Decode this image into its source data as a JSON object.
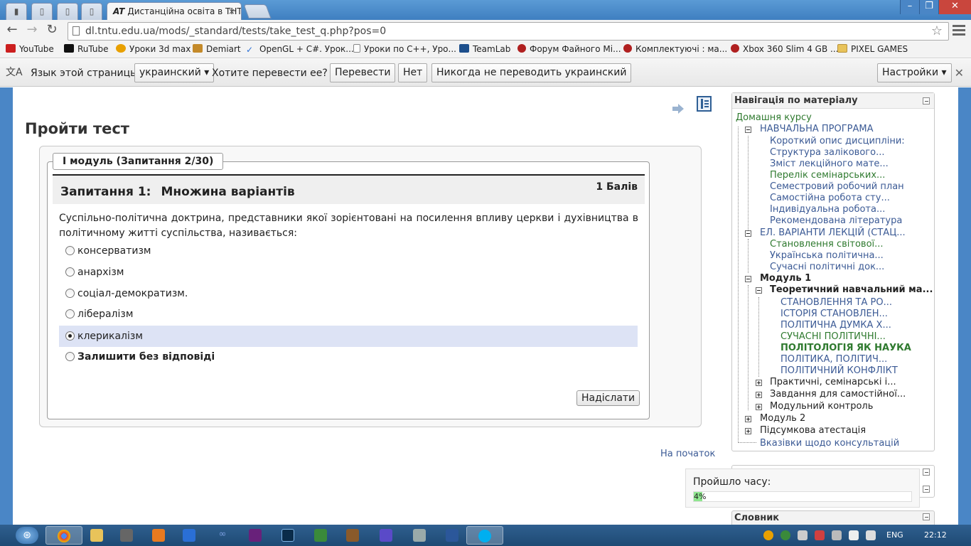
{
  "browser": {
    "tab_title": "Дистанційна освіта в ТНТ",
    "tab_favicon": "AT",
    "url": "dl.tntu.edu.ua/mods/_standard/tests/take_test_q.php?pos=0"
  },
  "bookmarks": [
    {
      "label": "YouTube",
      "icon": "youtube-icon",
      "color": "#cc1f1f"
    },
    {
      "label": "RuTube",
      "icon": "rutube-icon",
      "color": "#111111"
    },
    {
      "label": "Уроки 3d max",
      "icon": "3dmax-icon",
      "color": "#e8a000"
    },
    {
      "label": "Demiart",
      "icon": "demiart-icon",
      "color": "#c48a2a"
    },
    {
      "label": "OpenGL + C#. Урок...",
      "icon": "check-icon",
      "color": "#2a6fd6"
    },
    {
      "label": "Уроки по C++, Уро...",
      "icon": "page-icon",
      "color": "#ffffff"
    },
    {
      "label": "TeamLab",
      "icon": "teamlab-icon",
      "color": "#1d4f8c"
    },
    {
      "label": "Форум Файного Мі...",
      "icon": "forum-icon",
      "color": "#b02020"
    },
    {
      "label": "Комплектуючі : ма...",
      "icon": "forum-icon",
      "color": "#b02020"
    },
    {
      "label": "Xbox 360 Slim 4 GB ...",
      "icon": "forum-icon",
      "color": "#b02020"
    },
    {
      "label": "PIXEL GAMES",
      "icon": "folder-icon",
      "color": "#e8c35a"
    }
  ],
  "translate_bar": {
    "prompt": "Язык этой страницы",
    "language": "украинский",
    "question": "Хотите перевести ее?",
    "translate_btn": "Перевести",
    "no_btn": "Нет",
    "never_btn": "Никогда не переводить украинский",
    "settings_btn": "Настройки"
  },
  "page": {
    "title": "Пройти тест",
    "legend": "І модуль (Запитання 2/30)",
    "question_label": "Запитання 1:",
    "question_type": "Множина варіантів",
    "score": "1 Балів",
    "question_text": "Суспільно-політична доктрина, представники якої зорієнтовані на посилення впливу церкви і духівництва в політичному житті суспільства, називається:",
    "options": [
      {
        "label": "консерватизм",
        "selected": false,
        "bold": false
      },
      {
        "label": "анархізм",
        "selected": false,
        "bold": false
      },
      {
        "label": "соціал-демократизм.",
        "selected": false,
        "bold": false
      },
      {
        "label": "лібералізм",
        "selected": false,
        "bold": false
      },
      {
        "label": "клерикалізм",
        "selected": true,
        "bold": false
      },
      {
        "label": "Залишити без відповіді",
        "selected": false,
        "bold": true
      }
    ],
    "submit_label": "Надіслати",
    "to_top": "На початок"
  },
  "nav": {
    "title": "Навігація по матеріалу",
    "home": "Домашня курсу",
    "section1": "НАВЧАЛЬНА ПРОГРАМА",
    "section1_items": [
      "Короткий опис дисципліни:",
      "Структура залікового...",
      "Зміст лекційного мате...",
      "Перелік семінарських...",
      "Семестровий робочий план",
      "Самостійна робота сту...",
      "Індивідуальна робота...",
      "Рекомендована література"
    ],
    "section2": "ЕЛ. ВАРІАНТИ ЛЕКЦІЙ (СТАЦ...",
    "section2_items": [
      "Становлення світової...",
      "Українська політична...",
      "Сучасні політичні док..."
    ],
    "module1": "Модуль 1",
    "theory": "Теоретичний навчальний ма...",
    "theory_items": [
      "СТАНОВЛЕННЯ ТА РО...",
      "ІСТОРІЯ СТАНОВЛЕН...",
      "ПОЛІТИЧНА ДУМКА Х...",
      "СУЧАСНІ ПОЛІТИЧНІ...",
      "ПОЛІТОЛОГІЯ ЯК НАУКА",
      "ПОЛІТИКА, ПОЛІТИЧ...",
      "ПОЛІТИЧНИЙ КОНФЛІКТ"
    ],
    "practical": "Практичні, семінарські і...",
    "tasks": "Завдання для самостійної...",
    "control": "Модульний контроль",
    "module2": "Модуль 2",
    "final": "Підсумкова атестація",
    "consult": "Вказівки щодо консультацій"
  },
  "timer": {
    "label": "Пройшло часу:",
    "value": "4%",
    "percent": 4
  },
  "glossary": "Словник",
  "taskbar": {
    "language": "ENG",
    "time": "22:12"
  }
}
